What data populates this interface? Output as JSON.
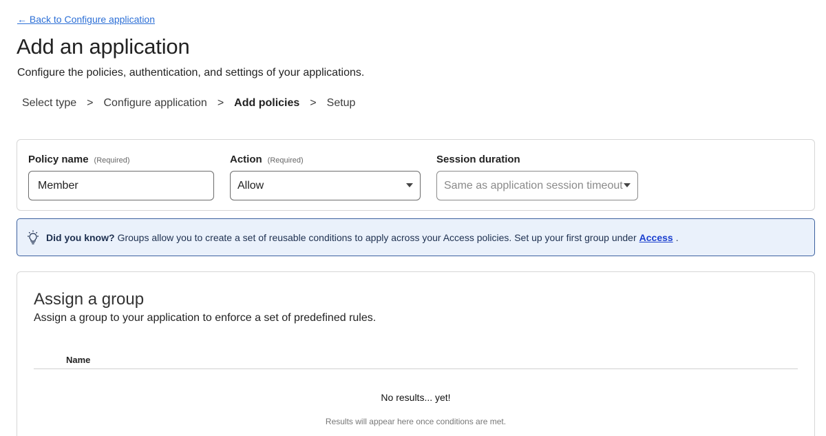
{
  "nav": {
    "back_label": "← Back to Configure application"
  },
  "header": {
    "title": "Add an application",
    "subtitle": "Configure the policies, authentication, and settings of your applications."
  },
  "steps": [
    {
      "label": "Select type",
      "active": false
    },
    {
      "label": "Configure application",
      "active": false
    },
    {
      "label": "Add policies",
      "active": true
    },
    {
      "label": "Setup",
      "active": false
    }
  ],
  "steps_separator": ">",
  "policy_form": {
    "policy_name": {
      "label": "Policy name",
      "required": "(Required)",
      "value": "Member"
    },
    "action": {
      "label": "Action",
      "required": "(Required)",
      "value": "Allow"
    },
    "session_duration": {
      "label": "Session duration",
      "placeholder": "Same as application session timeout"
    }
  },
  "info_banner": {
    "icon": "lightbulb-icon",
    "strong": "Did you know?",
    "text": "Groups allow you to create a set of reusable conditions to apply across your Access policies. Set up your first group under",
    "link": "Access",
    "trailing": "."
  },
  "group_section": {
    "title": "Assign a group",
    "subtitle": "Assign a group to your application to enforce a set of predefined rules.",
    "columns": [
      "Name"
    ],
    "empty_title": "No results... yet!",
    "empty_subtitle": "Results will appear here once conditions are met."
  },
  "colors": {
    "link": "#2c6fd6",
    "banner_bg": "#eaf1fb",
    "banner_border": "#3a5f9e",
    "banner_link": "#1a3fcf"
  }
}
